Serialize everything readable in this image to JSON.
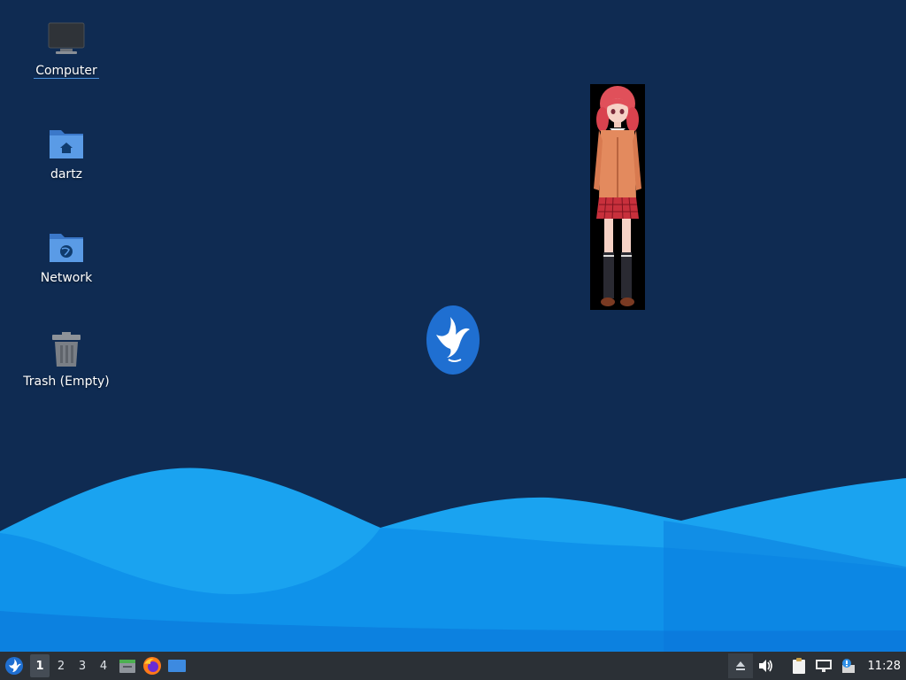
{
  "desktop": {
    "icons": [
      {
        "id": "computer",
        "label": "Computer",
        "icon": "monitor-icon"
      },
      {
        "id": "home",
        "label": "dartz",
        "icon": "home-folder-icon"
      },
      {
        "id": "network",
        "label": "Network",
        "icon": "network-folder-icon"
      },
      {
        "id": "trash",
        "label": "Trash (Empty)",
        "icon": "trash-icon"
      }
    ]
  },
  "colors": {
    "background": "#0f2b52",
    "wave_light": "#1aa3f0",
    "wave_mid": "#0e8ee8",
    "wave_dark": "#0a6fd6",
    "panel": "#2b3036",
    "accent": "#2d8ee6"
  },
  "panel": {
    "workspaces": [
      "1",
      "2",
      "3",
      "4"
    ],
    "active_workspace": "1",
    "launchers": [
      "menu-icon",
      "file-manager-icon",
      "firefox-icon",
      "desktop-icon"
    ],
    "tray": [
      "eject-icon",
      "volume-icon",
      "clipboard-icon",
      "network-icon",
      "update-icon"
    ],
    "clock": "11:28"
  }
}
